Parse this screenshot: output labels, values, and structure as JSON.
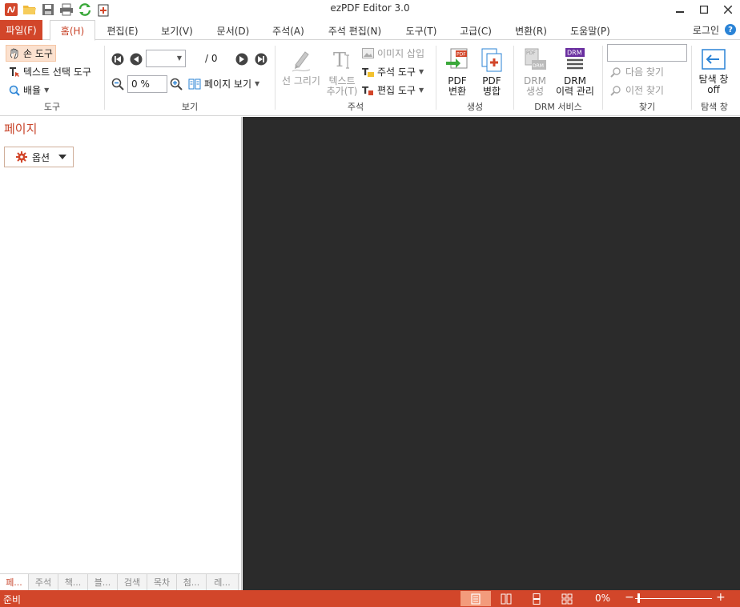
{
  "window": {
    "title": "ezPDF Editor 3.0"
  },
  "quick_access": [
    "app-logo-icon",
    "open-folder-icon",
    "save-icon",
    "print-icon",
    "sync-icon",
    "new-document-icon"
  ],
  "menu": {
    "file": "파일(F)",
    "tabs": [
      "홈(H)",
      "편집(E)",
      "보기(V)",
      "문서(D)",
      "주석(A)",
      "주석 편집(N)",
      "도구(T)",
      "고급(C)",
      "변환(R)",
      "도움말(P)"
    ],
    "login": "로그인",
    "help": "?"
  },
  "ribbon": {
    "tools": {
      "hand_tool": "손 도구",
      "text_select": "텍스트 선택 도구",
      "zoom_scale": "배율",
      "label": "도구"
    },
    "view": {
      "page_input": "",
      "page_total": "/ 0",
      "zoom_value": "0 %",
      "page_view": "페이지 보기",
      "label": "보기"
    },
    "annotation": {
      "draw_line": "선 그리기",
      "add_text_1": "텍스트",
      "add_text_2": "추가(T)",
      "insert_image": "이미지 삽입",
      "annot_tools": "주석 도구",
      "edit_tools": "편집 도구",
      "label": "주석"
    },
    "create": {
      "pdf_convert_1": "PDF",
      "pdf_convert_2": "변환",
      "pdf_merge_1": "PDF",
      "pdf_merge_2": "병합",
      "label": "생성"
    },
    "drm": {
      "drm_create_1": "DRM",
      "drm_create_2": "생성",
      "drm_history_1": "DRM",
      "drm_history_2": "이력 관리",
      "label": "DRM 서비스"
    },
    "find": {
      "search_value": "",
      "find_next": "다음 찾기",
      "find_prev": "이전 찾기",
      "label": "찾기"
    },
    "navpane": {
      "toggle_1": "탐색 창",
      "toggle_2": "off",
      "label": "탐색 창"
    }
  },
  "left_panel": {
    "title": "페이지",
    "options": "옵션",
    "bottom_tabs": [
      "페...",
      "주석",
      "책...",
      "블...",
      "검색",
      "목차",
      "첨...",
      "레..."
    ]
  },
  "status": {
    "text": "준비",
    "zoom": "0%",
    "minus": "−",
    "plus": "+"
  },
  "colors": {
    "accent": "#d2462a",
    "accent_text": "#c8442a",
    "doc_background": "#2b2b2b"
  }
}
